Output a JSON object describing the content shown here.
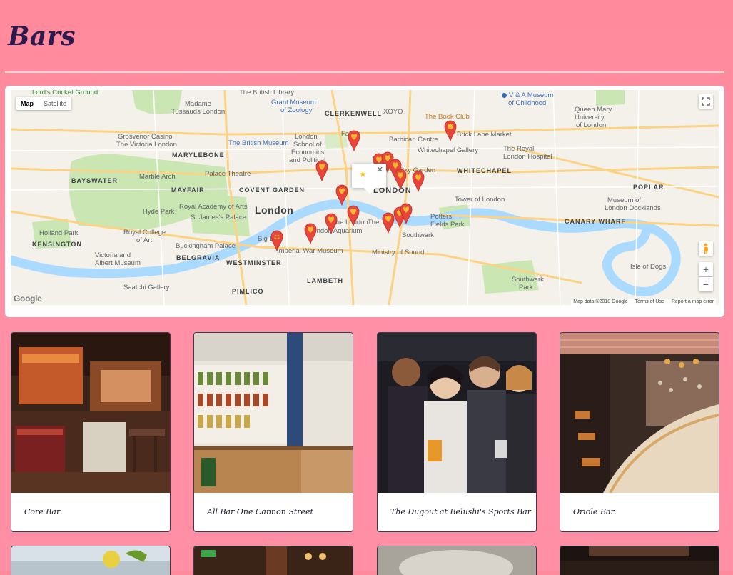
{
  "page": {
    "title": "Bars"
  },
  "map": {
    "type_controls": [
      "Map",
      "Satellite"
    ],
    "active_type": "Map",
    "footer": [
      "Map data ©2018 Google",
      "Terms of Use",
      "Report a map error"
    ],
    "logo": "Google",
    "labels": {
      "lords": "Lord's Cricket Ground",
      "british_library": "The British Library",
      "va_museum": "V & A Museum",
      "va_museum2": "of Childhood",
      "madame_tussauds": "Madame",
      "madame_tussauds2": "Tussauds London",
      "grant_museum": "Grant Museum",
      "grant_museum2": "of Zoology",
      "clerkenwell": "CLERKENWELL",
      "xoyo": "XOYO",
      "book_club": "The Book Club",
      "queen_mary": "Queen Mary",
      "queen_mary2": "University",
      "queen_mary3": "of London",
      "grosvenor": "Grosvenor Casino",
      "grosvenor2": "The Victoria London",
      "british_museum": "The British Museum",
      "lse": "London",
      "lse2": "School of",
      "lse3": "Economics",
      "lse4": "and Political",
      "fabric": "Fabric",
      "barbican": "Barbican Centre",
      "brick_lane": "Brick Lane Market",
      "marylebone": "MARYLEBONE",
      "whitechapel_gallery": "Whitechapel Gallery",
      "royal_london": "The Royal",
      "royal_london2": "London Hospital",
      "bayswater": "BAYSWATER",
      "marble_arch": "Marble Arch",
      "palace_theatre": "Palace Theatre",
      "sky_garden": "Sky Garden",
      "whitechapel": "WHITECHAPEL",
      "city_of_london": "LONDON",
      "mayfair": "MAYFAIR",
      "covent_garden": "COVENT GARDEN",
      "poplar": "POPLAR",
      "royal_academy": "Royal Academy of Arts",
      "london": "London",
      "tower": "Tower of London",
      "museum_docklands": "Museum of",
      "museum_docklands2": "London Docklands",
      "hyde_park": "Hyde Park",
      "st_james": "St James's Palace",
      "potters_fields": "Potters",
      "potters_fields2": "Fields Park",
      "holland_park": "Holland Park",
      "royal_college": "Royal College",
      "royal_college2": "of Art",
      "london_eye": "The London",
      "london_aquarium": "London Aquarium",
      "the_shard": "The",
      "southwark": "Southwark",
      "canary_wharf": "CANARY WHARF",
      "kensington": "KENSINGTON",
      "buckingham": "Buckingham Palace",
      "big_ben": "Big Ben",
      "imperial_war": "Imperial War Museum",
      "va": "Victoria and",
      "va2": "Albert Museum",
      "belgravia": "BELGRAVIA",
      "westminster": "WESTMINSTER",
      "ministry_sound": "Ministry of Sound",
      "isle_dogs": "Isle of Dogs",
      "lambeth": "LAMBETH",
      "southwark_park": "Southwark",
      "southwark_park2": "Park",
      "saatchi": "Saatchi Gallery",
      "pimlico": "PIMLICO"
    }
  },
  "bars": [
    {
      "name": "Core Bar"
    },
    {
      "name": "All Bar One Cannon Street"
    },
    {
      "name": "The Dugout at Belushi's Sports Bar"
    },
    {
      "name": "Oriole Bar"
    },
    {
      "name": ""
    },
    {
      "name": ""
    },
    {
      "name": ""
    },
    {
      "name": ""
    }
  ],
  "colors": {
    "pin": "#e8443a",
    "pin_heart": "#f7b731",
    "title": "#2a1a4e"
  }
}
